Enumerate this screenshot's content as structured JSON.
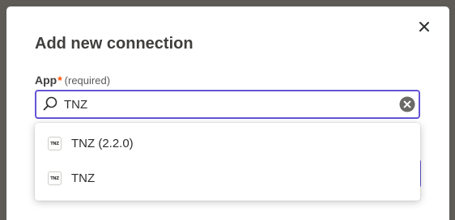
{
  "dialog": {
    "title": "Add new connection",
    "close_icon": "close-icon"
  },
  "field": {
    "label": "App",
    "required_mark": "*",
    "hint": "(required)",
    "value": "TNZ",
    "search_icon": "search-icon",
    "clear_icon": "clear-circle-icon"
  },
  "dropdown": {
    "options": [
      {
        "label": "TNZ (2.2.0)",
        "logo_text": "TNZ"
      },
      {
        "label": "TNZ",
        "logo_text": "TNZ"
      }
    ]
  },
  "colors": {
    "accent": "#6455d6",
    "required": "#ff4f00",
    "text": "#403f3e",
    "backdrop": "#5e5b56"
  }
}
